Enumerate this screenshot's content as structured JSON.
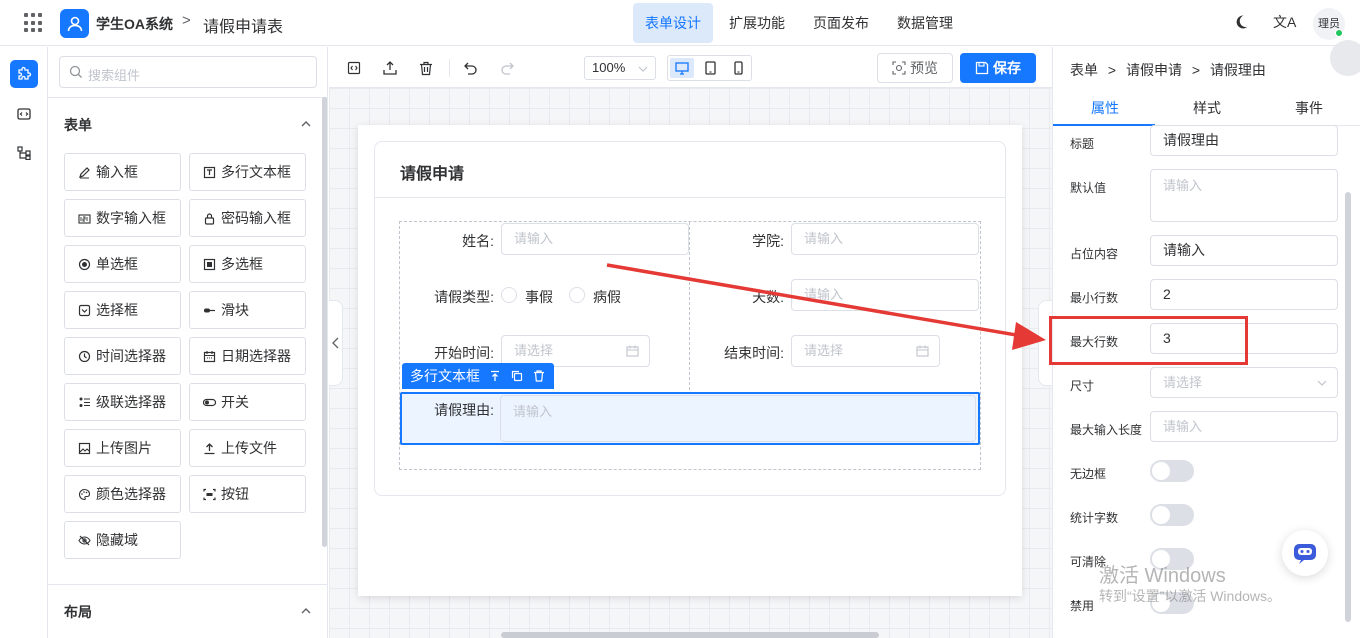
{
  "header": {
    "app_name": "学生OA系统",
    "separator": ">",
    "page_name": "请假申请表",
    "nav": [
      "表单设计",
      "扩展功能",
      "页面发布",
      "数据管理"
    ],
    "lang_glyph": "文A",
    "avatar_text": "理员"
  },
  "left_panel": {
    "search_placeholder": "搜索组件",
    "section_form": "表单",
    "components": [
      {
        "label": "输入框",
        "icon": "pencil-icon"
      },
      {
        "label": "多行文本框",
        "icon": "textarea-icon"
      },
      {
        "label": "数字输入框",
        "icon": "number-icon"
      },
      {
        "label": "密码输入框",
        "icon": "lock-icon"
      },
      {
        "label": "单选框",
        "icon": "radio-icon"
      },
      {
        "label": "多选框",
        "icon": "checkbox-icon"
      },
      {
        "label": "选择框",
        "icon": "select-icon"
      },
      {
        "label": "滑块",
        "icon": "slider-icon"
      },
      {
        "label": "时间选择器",
        "icon": "clock-icon"
      },
      {
        "label": "日期选择器",
        "icon": "calendar-icon"
      },
      {
        "label": "级联选择器",
        "icon": "cascader-icon"
      },
      {
        "label": "开关",
        "icon": "switch-icon"
      },
      {
        "label": "上传图片",
        "icon": "image-icon"
      },
      {
        "label": "上传文件",
        "icon": "upload-icon"
      },
      {
        "label": "颜色选择器",
        "icon": "palette-icon"
      },
      {
        "label": "按钮",
        "icon": "button-icon"
      },
      {
        "label": "隐藏域",
        "icon": "eye-off-icon"
      }
    ],
    "section_layout": "布局"
  },
  "toolbar": {
    "zoom": "100%",
    "preview": "预览",
    "save": "保存"
  },
  "form": {
    "title": "请假申请",
    "name_label": "姓名:",
    "college_label": "学院:",
    "type_label": "请假类型:",
    "type_options": [
      "事假",
      "病假"
    ],
    "days_label": "天数:",
    "start_label": "开始时间:",
    "end_label": "结束时间:",
    "reason_label": "请假理由:",
    "input_placeholder": "请输入",
    "select_placeholder": "请选择",
    "selected_tag": "多行文本框"
  },
  "right_panel": {
    "breadcrumb": [
      "表单",
      "请假申请",
      "请假理由"
    ],
    "tabs": [
      "属性",
      "样式",
      "事件"
    ],
    "props": [
      {
        "label": "标题",
        "value": "请假理由",
        "placeholder": ""
      },
      {
        "label": "默认值",
        "value": "",
        "placeholder": "请输入"
      },
      {
        "label": "占位内容",
        "value": "请输入",
        "placeholder": ""
      },
      {
        "label": "最小行数",
        "value": "2",
        "placeholder": ""
      },
      {
        "label": "最大行数",
        "value": "3",
        "placeholder": ""
      },
      {
        "label": "尺寸",
        "value": "",
        "placeholder": "请选择"
      },
      {
        "label": "最大输入长度",
        "value": "",
        "placeholder": "请输入"
      }
    ],
    "toggles": [
      "无边框",
      "统计字数",
      "可清除",
      "禁用"
    ]
  },
  "watermark": {
    "line1": "激活 Windows",
    "line2": "转到“设置”以激活 Windows。"
  },
  "colors": {
    "accent": "#1677ff",
    "annotation": "#e53935"
  }
}
